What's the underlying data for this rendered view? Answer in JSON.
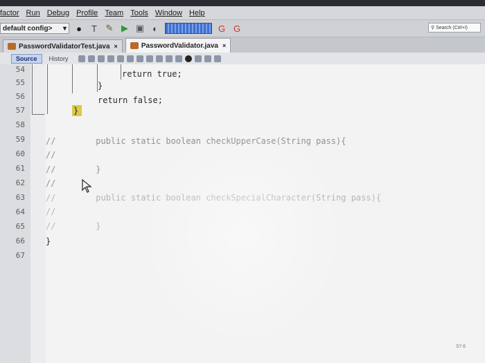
{
  "menu": [
    "factor",
    "Run",
    "Debug",
    "Profile",
    "Team",
    "Tools",
    "Window",
    "Help"
  ],
  "toolbar": {
    "config_value": "default config>",
    "search_placeholder": "Search (Ctrl+I)"
  },
  "tabs": [
    {
      "label": "PasswordValidatorTest.java",
      "close": "×",
      "active": false
    },
    {
      "label": "PasswordValidator.java",
      "close": "×",
      "active": true
    }
  ],
  "editor": {
    "source_label": "Source",
    "history_label": "History"
  },
  "lines": [
    {
      "num": "54",
      "text": "return true;"
    },
    {
      "num": "55",
      "text": "}"
    },
    {
      "num": "56",
      "text": "return false;"
    },
    {
      "num": "57",
      "text": "}"
    },
    {
      "num": "58",
      "text": ""
    },
    {
      "num": "59",
      "text": "//        public static boolean checkUpperCase(String pass){"
    },
    {
      "num": "60",
      "text": "//"
    },
    {
      "num": "61",
      "text": "//        }"
    },
    {
      "num": "62",
      "text": "//"
    },
    {
      "num": "63",
      "text": "//        public static boolean checkSpecialCharacter(String pass){"
    },
    {
      "num": "64",
      "text": "//"
    },
    {
      "num": "65",
      "text": "//        }"
    },
    {
      "num": "66",
      "text": "}"
    },
    {
      "num": "67",
      "text": ""
    }
  ],
  "status": {
    "position": "57:6"
  },
  "colors": {
    "brace_highlight": "#d4c22a",
    "source_button": "#c5d4ef"
  }
}
